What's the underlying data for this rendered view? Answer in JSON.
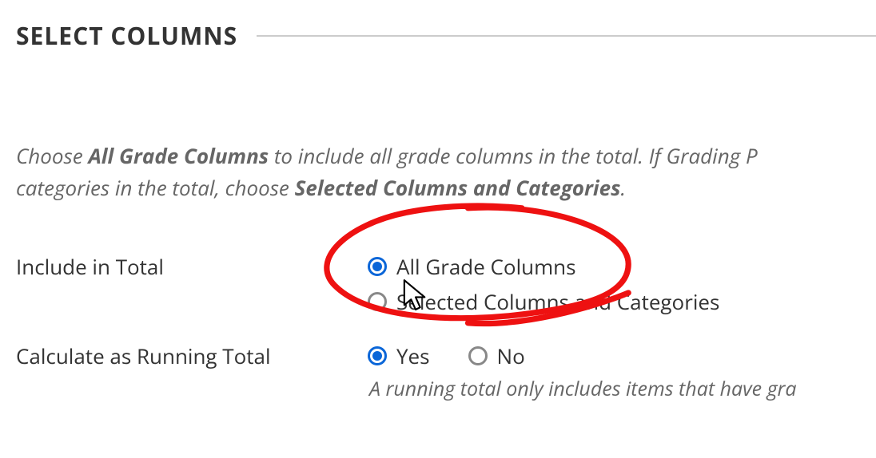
{
  "section": {
    "title": "SELECT COLUMNS"
  },
  "intro": {
    "prefix": "Choose ",
    "bold1": "All Grade Columns",
    "mid1": " to include all grade columns in the total. If Grading P",
    "line2_prefix": "categories in the total, choose ",
    "bold2": "Selected Columns and Categories",
    "line2_suffix": "."
  },
  "fields": {
    "includeInTotal": {
      "label": "Include in Total",
      "options": {
        "all": "All Grade Columns",
        "selected": "Selected Columns and Categories"
      }
    },
    "runningTotal": {
      "label": "Calculate as Running Total",
      "options": {
        "yes": "Yes",
        "no": "No"
      },
      "helper": "A running total only includes items that have gra"
    }
  }
}
